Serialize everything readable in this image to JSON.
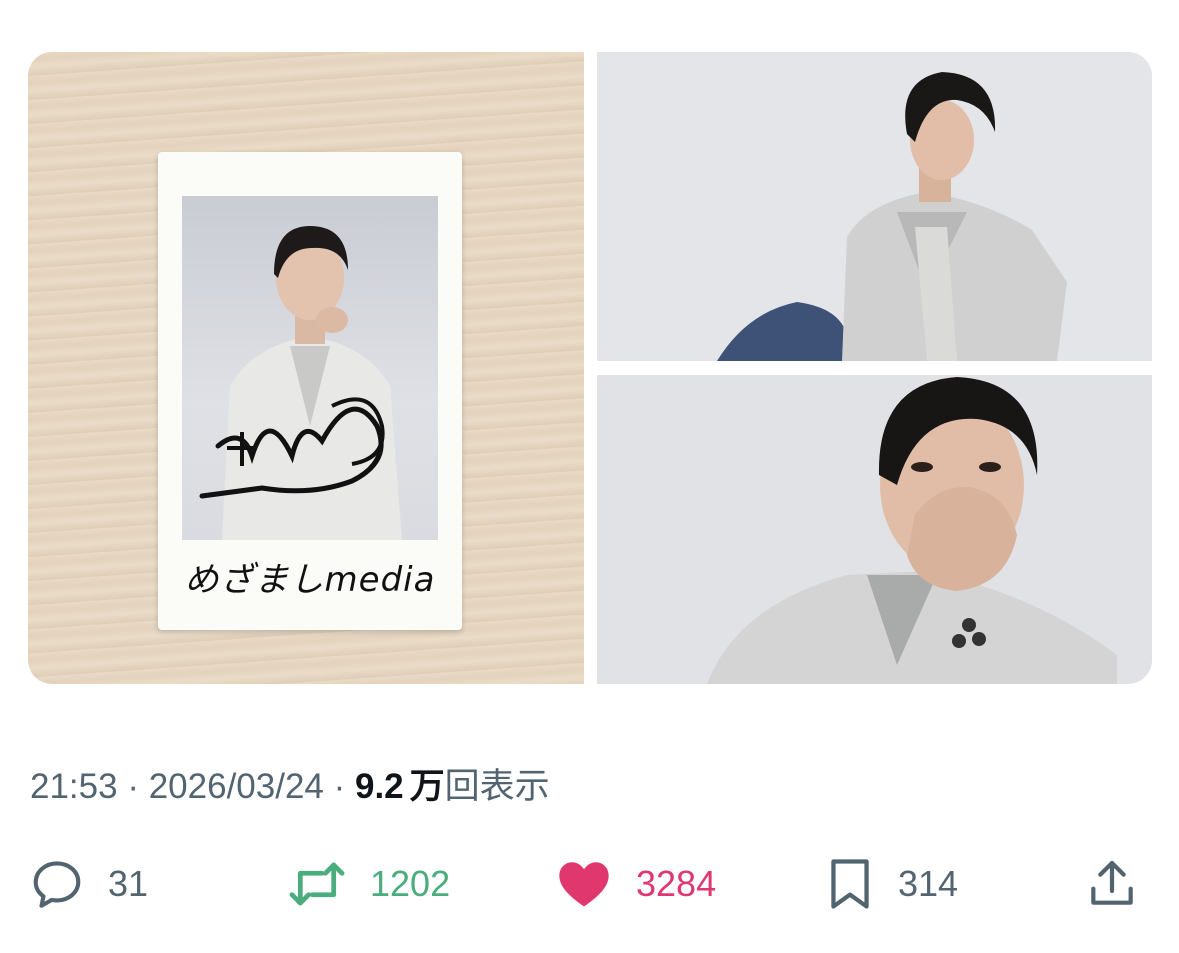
{
  "media": {
    "left_photo": {
      "caption": "めざましmedia"
    }
  },
  "meta": {
    "time": "21:53",
    "sep1": " · ",
    "date": "2026/03/24",
    "sep2": " · ",
    "views": "9.2",
    "views_unit": "万",
    "views_label": "回表示"
  },
  "actions": {
    "reply_count": "31",
    "retweet_count": "1202",
    "like_count": "3284",
    "bookmark_count": "314"
  },
  "colors": {
    "meta_gray": "#536471",
    "retweet_green": "#4bad7d",
    "like_pink": "#e0376f"
  },
  "icons": [
    "reply-icon",
    "retweet-icon",
    "like-icon",
    "bookmark-icon",
    "share-icon"
  ]
}
